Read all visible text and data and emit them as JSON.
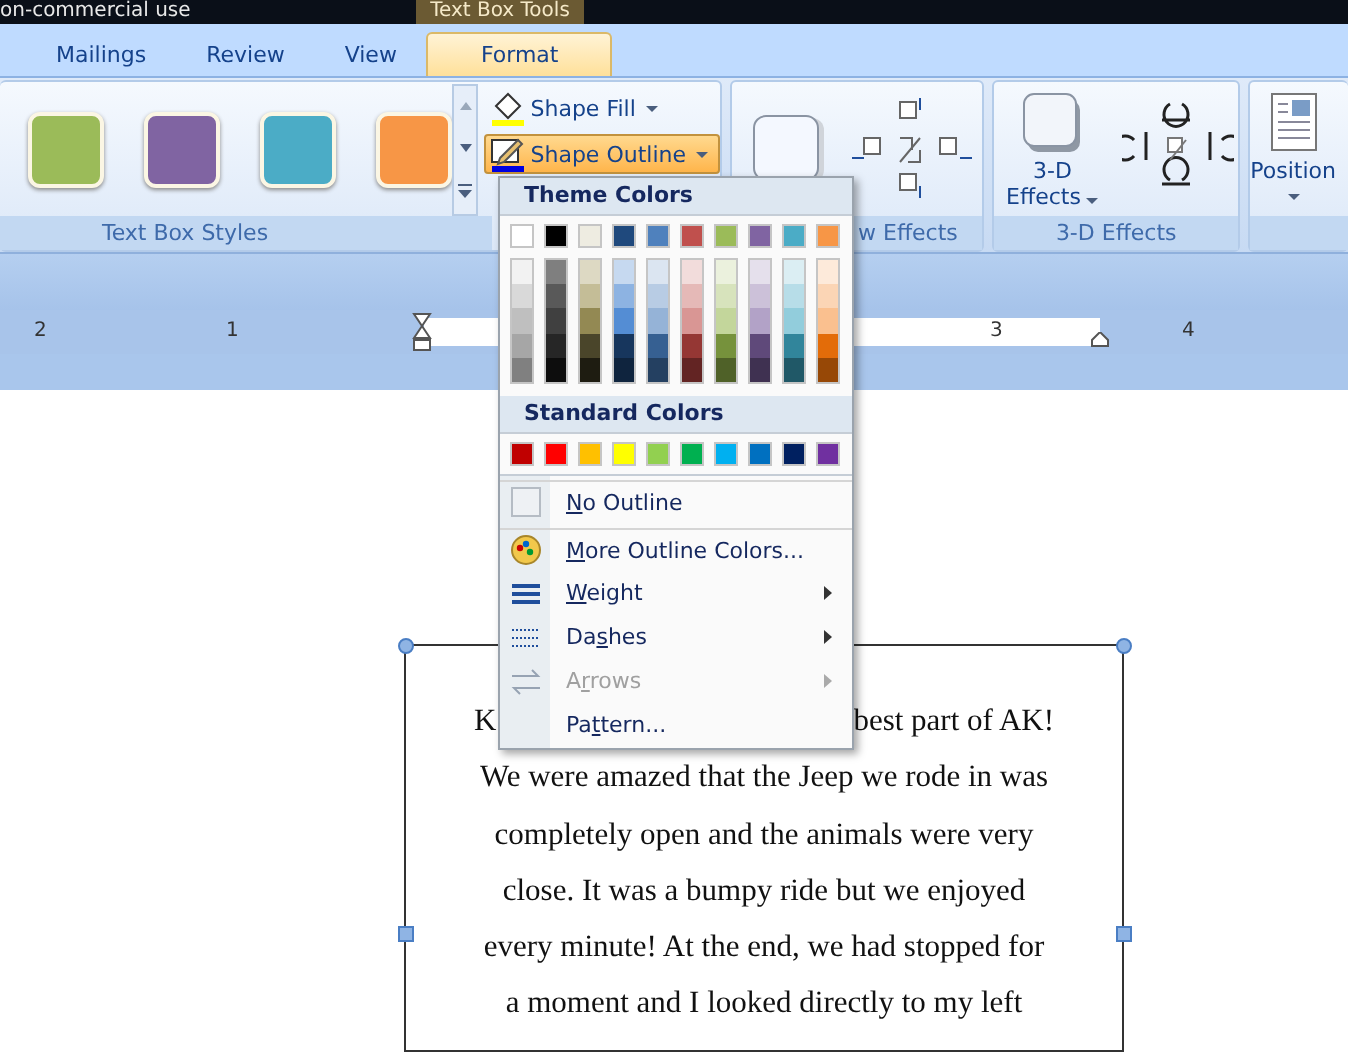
{
  "title_bar": {
    "document_title": "on-commercial use",
    "contextual_tab": "Text Box Tools"
  },
  "tabs": [
    {
      "label": "Mailings",
      "selected": false
    },
    {
      "label": "Review",
      "selected": false
    },
    {
      "label": "View",
      "selected": false
    },
    {
      "label": "Format",
      "selected": true
    }
  ],
  "ribbon": {
    "groups": [
      {
        "kind": "styles",
        "label": "Text Box Styles",
        "swatches": [
          {
            "color": "#9bbb59"
          },
          {
            "color": "#8064a2"
          },
          {
            "color": "#4bacc6"
          },
          {
            "color": "#f79646"
          }
        ],
        "commands": [
          {
            "label": "Shape Fill",
            "selected": false
          },
          {
            "label": "Shape Outline",
            "selected": true
          }
        ]
      },
      {
        "kind": "shadow",
        "label": "w Effects"
      },
      {
        "kind": "effects",
        "label": "3-D Effects",
        "button_lines": [
          "3-D",
          "Effects"
        ]
      },
      {
        "kind": "position",
        "button_lines": [
          "Position"
        ]
      }
    ]
  },
  "ruler": {
    "numbers": [
      "2",
      "1",
      "3",
      "4"
    ]
  },
  "outline_menu": {
    "theme_heading": "Theme Colors",
    "theme_colors": [
      {
        "color": "#ffffff"
      },
      {
        "color": "#000000"
      },
      {
        "color": "#eeece1"
      },
      {
        "color": "#1f497d"
      },
      {
        "color": "#4f81bd"
      },
      {
        "color": "#c0504d"
      },
      {
        "color": "#9bbb59"
      },
      {
        "color": "#8064a2"
      },
      {
        "color": "#4bacc6"
      },
      {
        "color": "#f79646"
      }
    ],
    "shade_columns": [
      [
        {
          "color": "#f2f2f2"
        },
        {
          "color": "#d9d9d9"
        },
        {
          "color": "#bfbfbf"
        },
        {
          "color": "#a6a6a6"
        },
        {
          "color": "#808080"
        }
      ],
      [
        {
          "color": "#7f7f7f"
        },
        {
          "color": "#595959"
        },
        {
          "color": "#404040"
        },
        {
          "color": "#262626"
        },
        {
          "color": "#0d0d0d"
        }
      ],
      [
        {
          "color": "#ddd9c3"
        },
        {
          "color": "#c4bd97"
        },
        {
          "color": "#938953"
        },
        {
          "color": "#4a452a"
        },
        {
          "color": "#1e1c11"
        }
      ],
      [
        {
          "color": "#c6d9f0"
        },
        {
          "color": "#8db3e2"
        },
        {
          "color": "#548dd4"
        },
        {
          "color": "#17365d"
        },
        {
          "color": "#0f243e"
        }
      ],
      [
        {
          "color": "#dbe5f1"
        },
        {
          "color": "#b8cce4"
        },
        {
          "color": "#95b3d7"
        },
        {
          "color": "#366092"
        },
        {
          "color": "#244061"
        }
      ],
      [
        {
          "color": "#f2dcdb"
        },
        {
          "color": "#e5b9b7"
        },
        {
          "color": "#d99694"
        },
        {
          "color": "#953734"
        },
        {
          "color": "#632423"
        }
      ],
      [
        {
          "color": "#ebf1dd"
        },
        {
          "color": "#d7e3bc"
        },
        {
          "color": "#c3d69b"
        },
        {
          "color": "#76923c"
        },
        {
          "color": "#4f6128"
        }
      ],
      [
        {
          "color": "#e5e0ec"
        },
        {
          "color": "#ccc1d9"
        },
        {
          "color": "#b2a2c7"
        },
        {
          "color": "#5f497a"
        },
        {
          "color": "#3f3151"
        }
      ],
      [
        {
          "color": "#dbeef3"
        },
        {
          "color": "#b7dde8"
        },
        {
          "color": "#92cddc"
        },
        {
          "color": "#31859b"
        },
        {
          "color": "#205867"
        }
      ],
      [
        {
          "color": "#fdeada"
        },
        {
          "color": "#fbd5b5"
        },
        {
          "color": "#fac08f"
        },
        {
          "color": "#e36c09"
        },
        {
          "color": "#974806"
        }
      ]
    ],
    "standard_heading": "Standard Colors",
    "standard_colors": [
      {
        "color": "#c00000"
      },
      {
        "color": "#ff0000"
      },
      {
        "color": "#ffc000"
      },
      {
        "color": "#ffff00"
      },
      {
        "color": "#92d050"
      },
      {
        "color": "#00b050"
      },
      {
        "color": "#00b0f0"
      },
      {
        "color": "#0070c0"
      },
      {
        "color": "#002060"
      },
      {
        "color": "#7030a0"
      }
    ],
    "items": [
      {
        "kind": "none",
        "label": {
          "mnemonic": "N",
          "after": "o Outline"
        },
        "submenu": false,
        "disabled": false
      },
      {
        "kind": "colors",
        "label": {
          "mnemonic": "M",
          "after": "ore Outline Colors..."
        },
        "submenu": false,
        "disabled": false
      },
      {
        "kind": "weight",
        "label": {
          "mnemonic": "W",
          "after": "eight"
        },
        "submenu": true,
        "disabled": false
      },
      {
        "kind": "dashes",
        "label": {
          "before": "Da",
          "mnemonic": "s",
          "after": "hes"
        },
        "submenu": true,
        "disabled": false
      },
      {
        "kind": "arrows",
        "label": {
          "before": "A",
          "mnemonic": "r",
          "after": "rows"
        },
        "submenu": true,
        "disabled": true
      },
      {
        "kind": "pattern",
        "label": {
          "before": "Pa",
          "mnemonic": "t",
          "after": "tern..."
        },
        "submenu": false,
        "disabled": false
      }
    ]
  },
  "text_box": {
    "first_line_fragments": [
      "K",
      "best part of AK!"
    ],
    "lines": [
      "We were amazed that the Jeep we rode in was",
      "completely open and the animals were very",
      "close. It was a bumpy ride but we enjoyed",
      "every minute! At the end, we had stopped for",
      "a moment and I looked directly to my left"
    ]
  }
}
